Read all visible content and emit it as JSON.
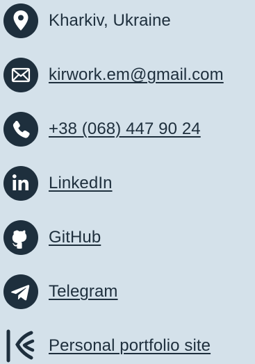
{
  "contacts": [
    {
      "icon": "location-pin-icon",
      "text": "Kharkiv, Ukraine",
      "is_link": false
    },
    {
      "icon": "mail-icon",
      "text": "kirwork.em@gmail.com",
      "is_link": true
    },
    {
      "icon": "phone-icon",
      "text": "+38 (068) 447 90 24",
      "is_link": true
    },
    {
      "icon": "linkedin-icon",
      "text": "LinkedIn",
      "is_link": true
    },
    {
      "icon": "github-icon",
      "text": "GitHub",
      "is_link": true
    },
    {
      "icon": "telegram-icon",
      "text": "Telegram",
      "is_link": true
    },
    {
      "icon": "portfolio-logo-icon",
      "text": "Personal portfolio site",
      "is_link": true
    }
  ],
  "colors": {
    "background": "#d4e1ea",
    "icon": "#1e2f3d",
    "text": "#1e2f3d"
  }
}
